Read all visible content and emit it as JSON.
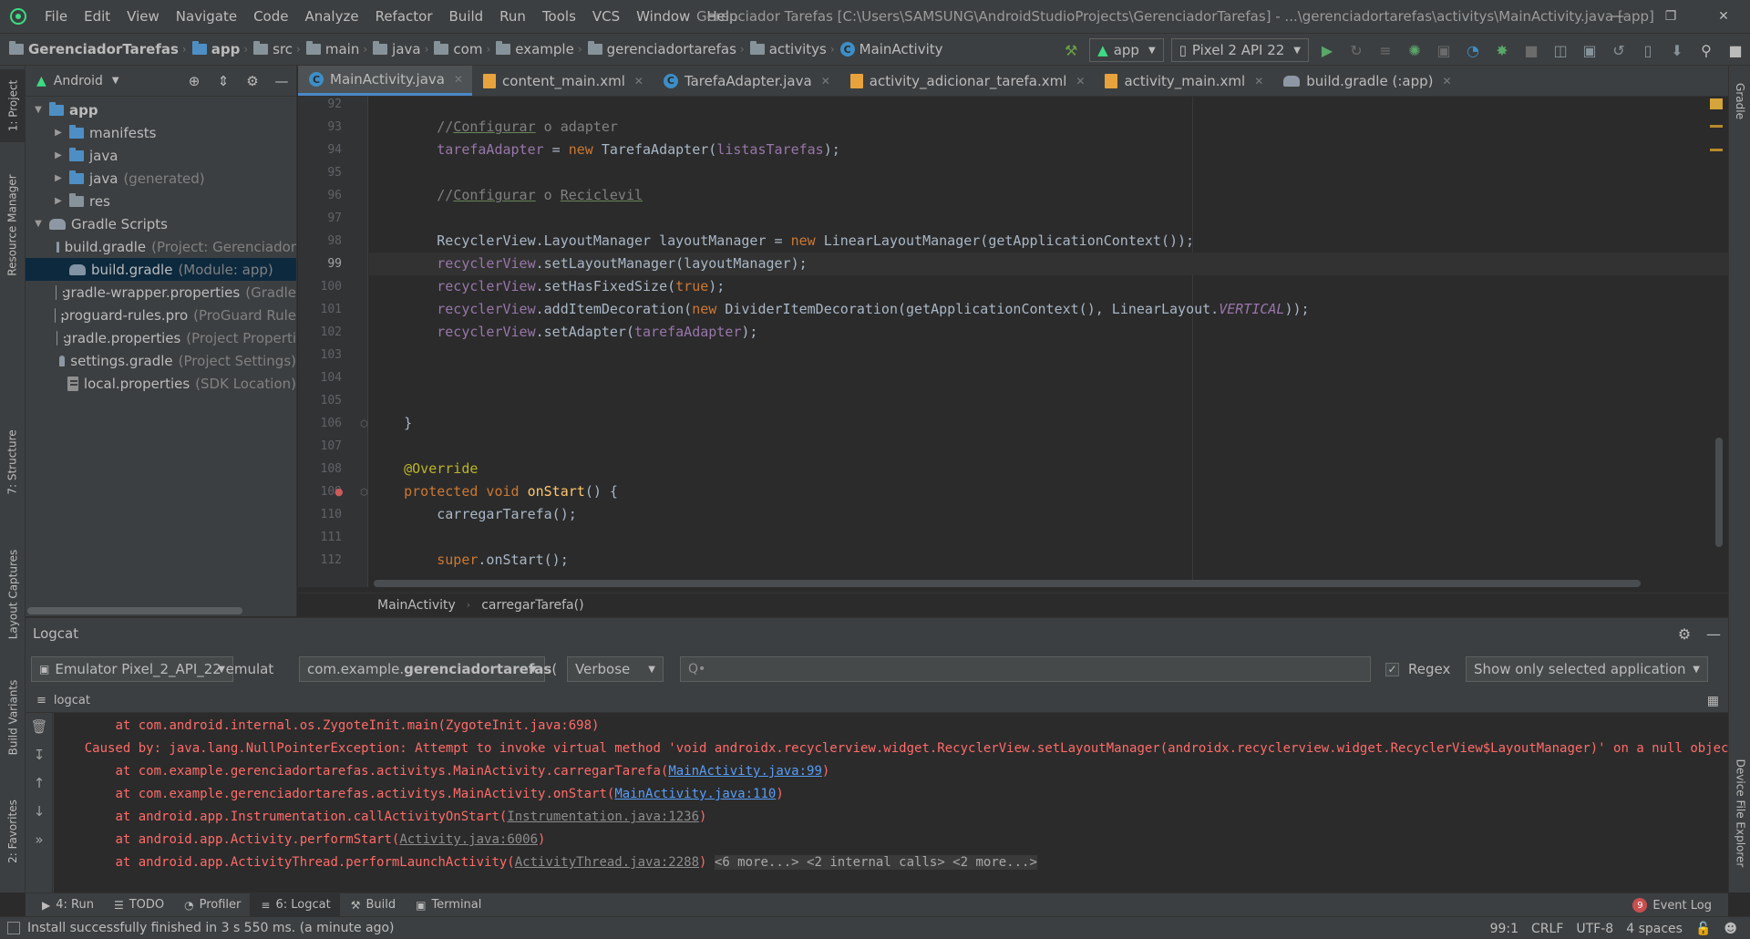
{
  "menubar": {
    "items": [
      "File",
      "Edit",
      "View",
      "Navigate",
      "Code",
      "Analyze",
      "Refactor",
      "Build",
      "Run",
      "Tools",
      "VCS",
      "Window",
      "Help"
    ],
    "window_title": "Gerenciador Tarefas [C:\\Users\\SAMSUNG\\AndroidStudioProjects\\GerenciadorTarefas] - ...\\gerenciadortarefas\\activitys\\MainActivity.java [app]"
  },
  "navbar": {
    "crumbs": [
      "GerenciadorTarefas",
      "app",
      "src",
      "main",
      "java",
      "com",
      "example",
      "gerenciadortarefas",
      "activitys",
      "MainActivity"
    ],
    "run_config": "app",
    "device": "Pixel 2 API 22"
  },
  "left_stripe": {
    "project": "1: Project",
    "resource_manager": "Resource Manager",
    "structure": "7: Structure",
    "layout_captures": "Layout Captures",
    "build_variants": "Build Variants",
    "favorites": "2: Favorites"
  },
  "right_stripe": {
    "gradle": "Gradle",
    "device_file_explorer": "Device File Explorer"
  },
  "project_panel": {
    "view_mode": "Android",
    "tree": [
      {
        "label": "app",
        "hint": "",
        "depth": 0,
        "expanded": true,
        "bold": true,
        "icon": "folder-icon"
      },
      {
        "label": "manifests",
        "hint": "",
        "depth": 1,
        "expanded": false,
        "icon": "folder-icon"
      },
      {
        "label": "java",
        "hint": "",
        "depth": 1,
        "expanded": false,
        "icon": "folder-icon"
      },
      {
        "label": "java",
        "hint": "(generated)",
        "depth": 1,
        "expanded": false,
        "icon": "generated-folder-icon"
      },
      {
        "label": "res",
        "hint": "",
        "depth": 1,
        "expanded": false,
        "icon": "res-folder-icon"
      },
      {
        "label": "Gradle Scripts",
        "hint": "",
        "depth": 0,
        "expanded": true,
        "icon": "gradle-icon"
      },
      {
        "label": "build.gradle",
        "hint": "(Project: Gerenciador",
        "depth": 1,
        "icon": "gradle-icon"
      },
      {
        "label": "build.gradle",
        "hint": "(Module: app)",
        "depth": 1,
        "icon": "gradle-icon",
        "selected": true
      },
      {
        "label": "gradle-wrapper.properties",
        "hint": "(Gradle",
        "depth": 1,
        "icon": "properties-icon"
      },
      {
        "label": "proguard-rules.pro",
        "hint": "(ProGuard Rule",
        "depth": 1,
        "icon": "properties-icon"
      },
      {
        "label": "gradle.properties",
        "hint": "(Project Properti",
        "depth": 1,
        "icon": "properties-icon"
      },
      {
        "label": "settings.gradle",
        "hint": "(Project Settings)",
        "depth": 1,
        "icon": "gradle-icon"
      },
      {
        "label": "local.properties",
        "hint": "(SDK Location)",
        "depth": 1,
        "icon": "properties-icon"
      }
    ]
  },
  "editor_tabs": [
    {
      "label": "MainActivity.java",
      "icon": "class-icon",
      "active": true
    },
    {
      "label": "content_main.xml",
      "icon": "xml-icon"
    },
    {
      "label": "TarefaAdapter.java",
      "icon": "class-icon"
    },
    {
      "label": "activity_adicionar_tarefa.xml",
      "icon": "xml-icon"
    },
    {
      "label": "activity_main.xml",
      "icon": "xml-icon"
    },
    {
      "label": "build.gradle (:app)",
      "icon": "gradle-icon"
    }
  ],
  "editor": {
    "current_line": 99,
    "lines": [
      {
        "n": 92,
        "tokens": []
      },
      {
        "n": 93,
        "tokens": [
          {
            "t": "        ",
            "c": ""
          },
          {
            "t": "//",
            "c": "cm"
          },
          {
            "t": "Configurar",
            "c": "cm und"
          },
          {
            "t": " o adapter",
            "c": "cm"
          }
        ]
      },
      {
        "n": 94,
        "tokens": [
          {
            "t": "        ",
            "c": ""
          },
          {
            "t": "tarefaAdapter",
            "c": "fld"
          },
          {
            "t": " = ",
            "c": ""
          },
          {
            "t": "new ",
            "c": "kw"
          },
          {
            "t": "TarefaAdapter(",
            "c": ""
          },
          {
            "t": "listasTarefas",
            "c": "fld"
          },
          {
            "t": ");",
            "c": ""
          }
        ]
      },
      {
        "n": 95,
        "tokens": []
      },
      {
        "n": 96,
        "tokens": [
          {
            "t": "        ",
            "c": ""
          },
          {
            "t": "//",
            "c": "cm"
          },
          {
            "t": "Configurar",
            "c": "cm und"
          },
          {
            "t": " o ",
            "c": "cm"
          },
          {
            "t": "Reciclevil",
            "c": "cm und"
          }
        ]
      },
      {
        "n": 97,
        "tokens": []
      },
      {
        "n": 98,
        "tokens": [
          {
            "t": "        RecyclerView.LayoutManager layoutManager = ",
            "c": ""
          },
          {
            "t": "new ",
            "c": "kw"
          },
          {
            "t": "LinearLayoutManager(getApplicationContext());",
            "c": ""
          }
        ]
      },
      {
        "n": 99,
        "tokens": [
          {
            "t": "        ",
            "c": ""
          },
          {
            "t": "recyclerView",
            "c": "fld"
          },
          {
            "t": ".setLayoutManager(layoutManager);",
            "c": ""
          }
        ]
      },
      {
        "n": 100,
        "tokens": [
          {
            "t": "        ",
            "c": ""
          },
          {
            "t": "recyclerView",
            "c": "fld"
          },
          {
            "t": ".setHasFixedSize(",
            "c": ""
          },
          {
            "t": "true",
            "c": "kw"
          },
          {
            "t": ");",
            "c": ""
          }
        ]
      },
      {
        "n": 101,
        "tokens": [
          {
            "t": "        ",
            "c": ""
          },
          {
            "t": "recyclerView",
            "c": "fld"
          },
          {
            "t": ".addItemDecoration(",
            "c": ""
          },
          {
            "t": "new ",
            "c": "kw"
          },
          {
            "t": "DividerItemDecoration(getApplicationContext(), LinearLayout.",
            "c": ""
          },
          {
            "t": "VERTICAL",
            "c": "it"
          },
          {
            "t": "));",
            "c": ""
          }
        ]
      },
      {
        "n": 102,
        "tokens": [
          {
            "t": "        ",
            "c": ""
          },
          {
            "t": "recyclerView",
            "c": "fld"
          },
          {
            "t": ".setAdapter(",
            "c": ""
          },
          {
            "t": "tarefaAdapter",
            "c": "fld"
          },
          {
            "t": ");",
            "c": ""
          }
        ]
      },
      {
        "n": 103,
        "tokens": []
      },
      {
        "n": 104,
        "tokens": []
      },
      {
        "n": 105,
        "tokens": []
      },
      {
        "n": 106,
        "tokens": [
          {
            "t": "    }",
            "c": ""
          }
        ]
      },
      {
        "n": 107,
        "tokens": []
      },
      {
        "n": 108,
        "tokens": [
          {
            "t": "    ",
            "c": ""
          },
          {
            "t": "@Override",
            "c": "an"
          }
        ]
      },
      {
        "n": 109,
        "tokens": [
          {
            "t": "    ",
            "c": ""
          },
          {
            "t": "protected void ",
            "c": "kw"
          },
          {
            "t": "onStart",
            "c": "fn"
          },
          {
            "t": "() {",
            "c": ""
          }
        ]
      },
      {
        "n": 110,
        "tokens": [
          {
            "t": "        carregarTarefa();",
            "c": ""
          }
        ]
      },
      {
        "n": 111,
        "tokens": []
      },
      {
        "n": 112,
        "tokens": [
          {
            "t": "        ",
            "c": ""
          },
          {
            "t": "super",
            "c": "kw"
          },
          {
            "t": ".onStart();",
            "c": ""
          }
        ]
      }
    ],
    "breadcrumb": [
      "MainActivity",
      "carregarTarefa()"
    ]
  },
  "logcat": {
    "title": "Logcat",
    "device": "Emulator Pixel_2_API_22 emulat",
    "package_prefix": "com.example.",
    "package_bold": "gerenciadortarefas",
    "package_suffix": " (",
    "level": "Verbose",
    "search_placeholder": "Q•",
    "regex_label": "Regex",
    "regex_checked": true,
    "filter": "Show only selected application",
    "subtab": "logcat",
    "lines": [
      {
        "parts": [
          {
            "t": "at com.android.internal.os.ZygoteInit.main(ZygoteInit.java:698)",
            "k": ""
          }
        ],
        "indent": "        "
      },
      {
        "parts": [
          {
            "t": "Caused by: java.lang.NullPointerException: Attempt to invoke virtual method 'void androidx.recyclerview.widget.RecyclerView.setLayoutManager(androidx.recyclerview.widget.RecyclerView$LayoutManager)' on a null object reference",
            "k": ""
          }
        ],
        "indent": "    "
      },
      {
        "parts": [
          {
            "t": "at com.example.gerenciadortarefas.activitys.MainActivity.carregarTarefa(",
            "k": ""
          },
          {
            "t": "MainActivity.java:99",
            "k": "link"
          },
          {
            "t": ")",
            "k": ""
          }
        ],
        "indent": "        "
      },
      {
        "parts": [
          {
            "t": "at com.example.gerenciadortarefas.activitys.MainActivity.onStart(",
            "k": ""
          },
          {
            "t": "MainActivity.java:110",
            "k": "link"
          },
          {
            "t": ")",
            "k": ""
          }
        ],
        "indent": "        "
      },
      {
        "parts": [
          {
            "t": "at android.app.Instrumentation.callActivityOnStart(",
            "k": ""
          },
          {
            "t": "Instrumentation.java:1236",
            "k": "faint"
          },
          {
            "t": ")",
            "k": ""
          }
        ],
        "indent": "        "
      },
      {
        "parts": [
          {
            "t": "at android.app.Activity.performStart(",
            "k": ""
          },
          {
            "t": "Activity.java:6006",
            "k": "faint"
          },
          {
            "t": ")",
            "k": ""
          }
        ],
        "indent": "        "
      },
      {
        "parts": [
          {
            "t": "at android.app.ActivityThread.performLaunchActivity(",
            "k": ""
          },
          {
            "t": "ActivityThread.java:2288",
            "k": "faint"
          },
          {
            "t": ") ",
            "k": ""
          },
          {
            "t": "<6 more...>",
            "k": "more"
          },
          {
            "t": " <2 internal calls> <2 more...>",
            "k": "more"
          }
        ],
        "indent": "        "
      }
    ]
  },
  "tool_tabs": [
    {
      "label": "4: Run",
      "icon": "play-icon"
    },
    {
      "label": "TODO",
      "icon": "list-icon"
    },
    {
      "label": "Profiler",
      "icon": "gauge-icon"
    },
    {
      "label": "6: Logcat",
      "icon": "logcat-icon",
      "active": true
    },
    {
      "label": "Build",
      "icon": "hammer-icon"
    },
    {
      "label": "Terminal",
      "icon": "terminal-icon"
    }
  ],
  "event_log": {
    "label": "Event Log",
    "count": "9"
  },
  "status": {
    "message": "Install successfully finished in 3 s 550 ms. (a minute ago)",
    "position": "99:1",
    "line_sep": "CRLF",
    "encoding": "UTF-8",
    "indent": "4 spaces"
  },
  "colors": {
    "accent": "#4a88c7",
    "error_text": "#ff6b68",
    "link": "#589df6"
  }
}
